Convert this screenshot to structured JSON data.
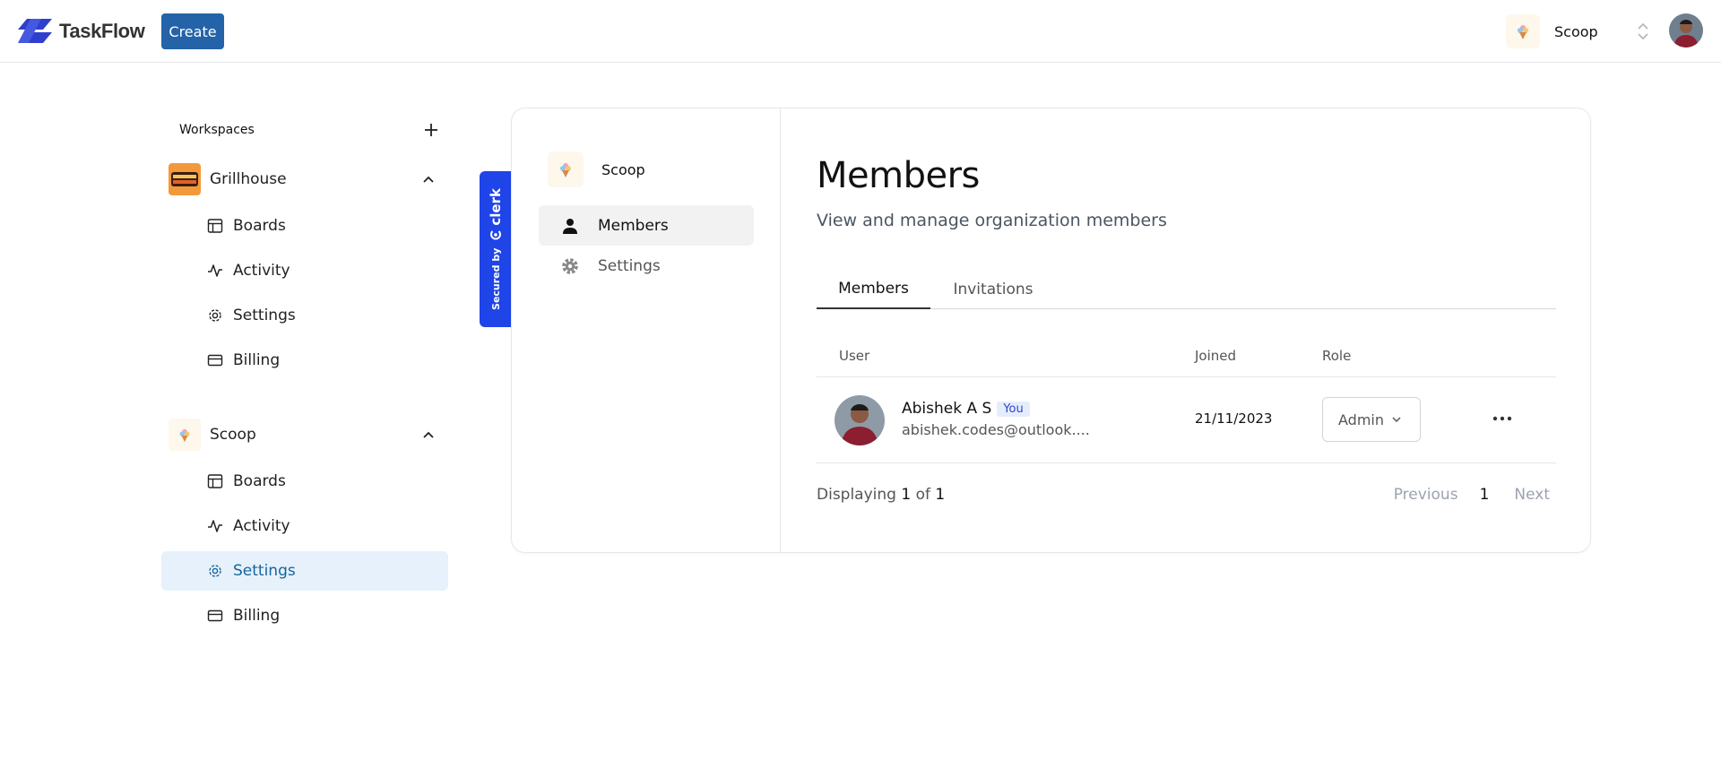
{
  "navbar": {
    "brand": "TaskFlow",
    "create_label": "Create",
    "org_name": "Scoop"
  },
  "sidebar": {
    "title": "Workspaces",
    "orgs": [
      {
        "name": "Grillhouse",
        "items": [
          {
            "label": "Boards",
            "icon": "board-icon"
          },
          {
            "label": "Activity",
            "icon": "activity-icon"
          },
          {
            "label": "Settings",
            "icon": "settings-icon"
          },
          {
            "label": "Billing",
            "icon": "credit-card-icon"
          }
        ]
      },
      {
        "name": "Scoop",
        "items": [
          {
            "label": "Boards",
            "icon": "board-icon"
          },
          {
            "label": "Activity",
            "icon": "activity-icon"
          },
          {
            "label": "Settings",
            "icon": "settings-icon",
            "active": true
          },
          {
            "label": "Billing",
            "icon": "credit-card-icon"
          }
        ]
      }
    ]
  },
  "clerk_badge": {
    "secured_by": "Secured by",
    "brand": "clerk"
  },
  "org_profile": {
    "org_name": "Scoop",
    "nav": [
      {
        "label": "Members",
        "icon": "user-icon",
        "active": true
      },
      {
        "label": "Settings",
        "icon": "gear-icon"
      }
    ],
    "title": "Members",
    "subtitle": "View and manage organization members",
    "tabs": [
      {
        "label": "Members",
        "active": true
      },
      {
        "label": "Invitations"
      }
    ],
    "table": {
      "headers": [
        "User",
        "Joined",
        "Role"
      ],
      "rows": [
        {
          "name": "Abishek A S",
          "badge": "You",
          "email": "abishek.codes@outlook....",
          "joined": "21/11/2023",
          "role": "Admin"
        }
      ]
    },
    "footer": {
      "displaying": "Displaying",
      "current": "1",
      "of": "of",
      "total": "1",
      "previous": "Previous",
      "page": "1",
      "next": "Next"
    }
  },
  "colors": {
    "brand_blue": "#2563a8",
    "clerk_blue": "#1f44e8",
    "active_bg": "#e7f1fb",
    "active_text": "#14659e"
  }
}
